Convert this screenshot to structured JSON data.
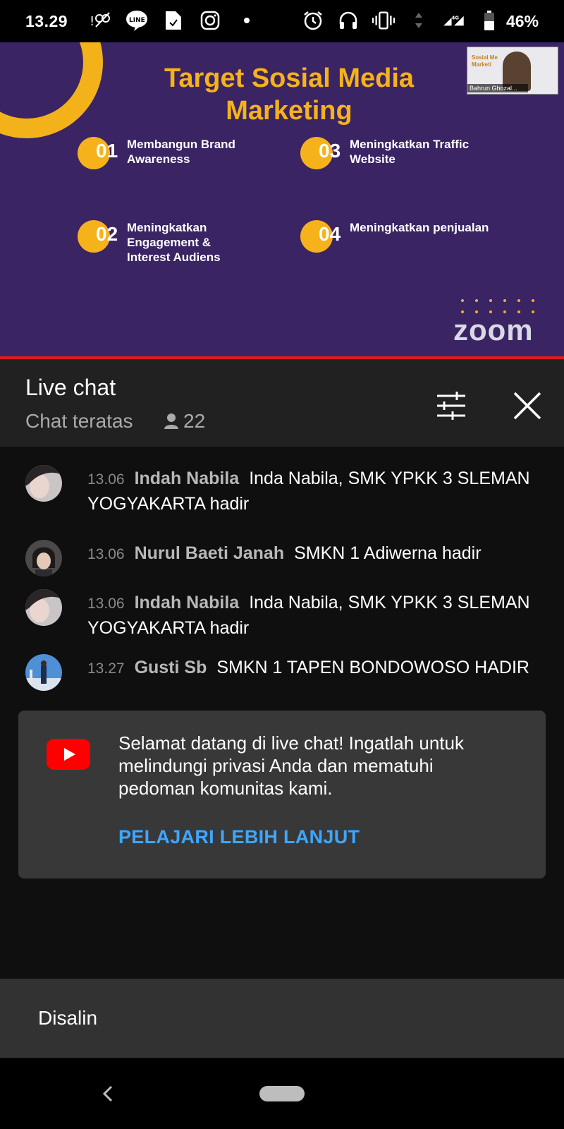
{
  "status_bar": {
    "time": "13.29",
    "network": "4G",
    "battery": "46%",
    "icons": [
      "notification-icon",
      "line-icon",
      "file-icon",
      "instagram-icon",
      "dot-icon",
      "alarm-icon",
      "headset-icon",
      "vibrate-icon",
      "signal-icon",
      "battery-icon"
    ]
  },
  "video": {
    "slide_title": "Target Sosial Media Marketing",
    "items": [
      {
        "num": "01",
        "label": "Membangun Brand\nAwareness"
      },
      {
        "num": "02",
        "label": "Meningkatkan\nEngagement &\nInterest Audiens"
      },
      {
        "num": "03",
        "label": "Meningkatkan Traffic\nWebsite"
      },
      {
        "num": "04",
        "label": "Meningkatkan penjualan"
      }
    ],
    "pip_name": "Bahrun Ghozal...",
    "pip_text": "Sosial Me\nMarketi",
    "logo": "zoom",
    "accent": "#f6b21b",
    "background": "#3a2464"
  },
  "chat": {
    "title": "Live chat",
    "mode": "Chat teratas",
    "viewer_count": "22",
    "messages": [
      {
        "time": "13.06",
        "author": "Indah Nabila",
        "text": "Inda Nabila, SMK YPKK 3 SLEMAN YOGYAKARTA hadir"
      },
      {
        "time": "13.06",
        "author": "Nurul Baeti Janah",
        "text": "SMKN 1 Adiwerna hadir"
      },
      {
        "time": "13.06",
        "author": "Indah Nabila",
        "text": "Inda Nabila, SMK YPKK 3 SLEMAN YOGYAKARTA hadir"
      },
      {
        "time": "13.27",
        "author": "Gusti Sb",
        "text": "SMKN 1 TAPEN BONDOWOSO HADIR"
      }
    ]
  },
  "welcome": {
    "message": "Selamat datang di live chat! Ingatlah untuk melindungi privasi Anda dan mematuhi pedoman komunitas kami.",
    "link": "PELAJARI LEBIH LANJUT"
  },
  "toast": {
    "text": "Disalin"
  }
}
